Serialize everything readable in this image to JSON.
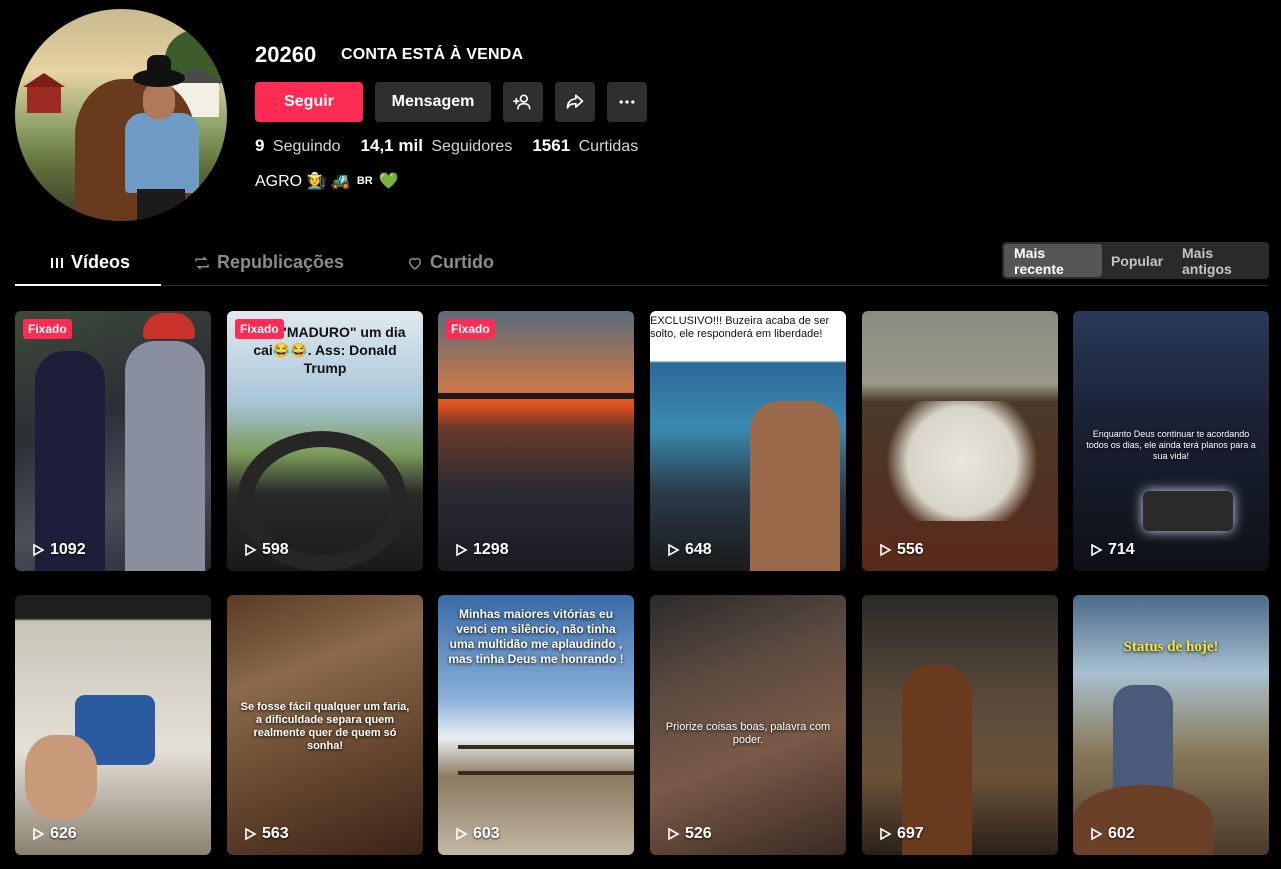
{
  "profile": {
    "username": "20260",
    "nickname": "CONTA ESTÁ À VENDA",
    "bio_text": "AGRO 🧑‍🌾 🚜",
    "bio_small": "BR",
    "bio_heart": "💚"
  },
  "actions": {
    "follow": "Seguir",
    "message": "Mensagem",
    "add_friend_icon": "add-friend-icon",
    "share_icon": "share-icon",
    "more_icon": "more-icon"
  },
  "stats": {
    "following_count": "9",
    "following_label": "Seguindo",
    "followers_count": "14,1 mil",
    "followers_label": "Seguidores",
    "likes_count": "1561",
    "likes_label": "Curtidas"
  },
  "tabs": {
    "videos": "Vídeos",
    "reposts": "Republicações",
    "liked": "Curtido"
  },
  "sort": {
    "recent": "Mais recente",
    "popular": "Popular",
    "oldest": "Mais antigos"
  },
  "videos": [
    {
      "pinned": "Fixado",
      "plays": "1092",
      "caption": ""
    },
    {
      "pinned": "Fixado",
      "plays": "598",
      "caption": "fruto \"MADURO\" um dia cai😂😂. Ass: Donald Trump"
    },
    {
      "pinned": "Fixado",
      "plays": "1298",
      "caption": ""
    },
    {
      "pinned": "",
      "plays": "648",
      "caption": "EXCLUSIVO!!! Buzeira acaba de ser solto, ele responderá em liberdade!"
    },
    {
      "pinned": "",
      "plays": "556",
      "caption": ""
    },
    {
      "pinned": "",
      "plays": "714",
      "caption": "Enquanto Deus continuar te acordando todos os dias, ele ainda terá planos para a sua vida!"
    },
    {
      "pinned": "",
      "plays": "626",
      "caption": ""
    },
    {
      "pinned": "",
      "plays": "563",
      "caption": "Se fosse fácil qualquer um faria, a dificuldade separa quem realmente quer de quem só sonha!"
    },
    {
      "pinned": "",
      "plays": "603",
      "caption": "Minhas maiores vitórias eu venci em silêncio, não tinha uma multidão me aplaudindo , mas tinha Deus me honrando !"
    },
    {
      "pinned": "",
      "plays": "526",
      "caption": "Priorize coisas boas, palavra com poder."
    },
    {
      "pinned": "",
      "plays": "697",
      "caption": ""
    },
    {
      "pinned": "",
      "plays": "602",
      "caption": "Status de hoje!"
    }
  ],
  "colors": {
    "accent": "#fe2c55",
    "background": "#000000",
    "button_dark": "#2f2f2f"
  }
}
